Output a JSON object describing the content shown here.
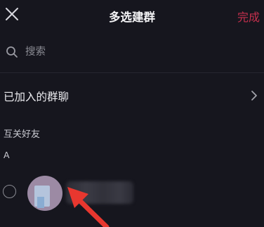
{
  "header": {
    "title": "多选建群",
    "done_label": "完成",
    "close_icon": "close-icon"
  },
  "search": {
    "placeholder": "搜索",
    "icon": "search-icon"
  },
  "joined_groups": {
    "label": "已加入的群聊",
    "icon": "chevron-right-icon"
  },
  "friends": {
    "section_title": "互关好友",
    "index_letter": "A"
  },
  "colors": {
    "background": "#16161e",
    "accent_done": "#c5304d",
    "annotation_arrow": "#e8372f"
  }
}
